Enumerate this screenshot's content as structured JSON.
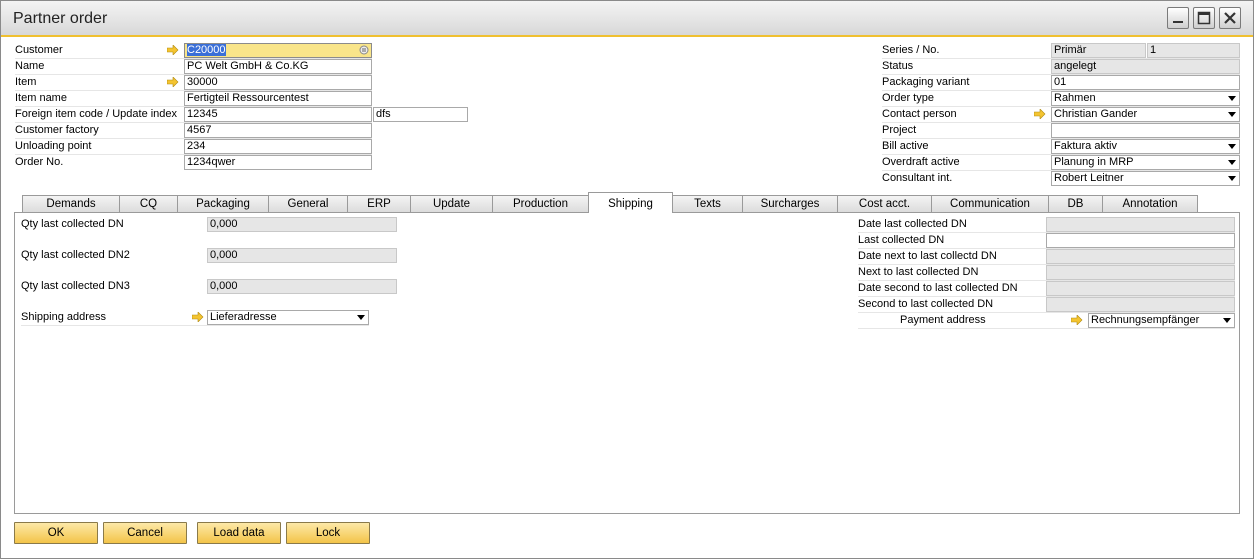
{
  "window": {
    "title": "Partner order"
  },
  "header_left": [
    {
      "label": "Customer",
      "value": "C20000",
      "link": true
    },
    {
      "label": "Name",
      "value": "PC Welt GmbH & Co.KG"
    },
    {
      "label": "Item",
      "value": "30000",
      "link": true
    },
    {
      "label": "Item name",
      "value": "Fertigteil Ressourcentest"
    },
    {
      "label": "Foreign item code / Update index",
      "value": "12345",
      "value2": "dfs"
    },
    {
      "label": "Customer factory",
      "value": "4567"
    },
    {
      "label": "Unloading point",
      "value": "234"
    },
    {
      "label": "Order No.",
      "value": "1234qwer"
    }
  ],
  "header_right": [
    {
      "label": "Series / No.",
      "value": "Primär",
      "value2": "1"
    },
    {
      "label": "Status",
      "value": "angelegt"
    },
    {
      "label": "Packaging variant",
      "value": "01"
    },
    {
      "label": "Order type",
      "value": "Rahmen"
    },
    {
      "label": "Contact person",
      "value": "Christian Gander",
      "link": true
    },
    {
      "label": "Project",
      "value": ""
    },
    {
      "label": "Bill active",
      "value": "Faktura aktiv"
    },
    {
      "label": "Overdraft active",
      "value": "Planung in MRP"
    },
    {
      "label": "Consultant int.",
      "value": "Robert Leitner"
    }
  ],
  "tabs": [
    "Demands",
    "CQ",
    "Packaging",
    "General",
    "ERP",
    "Update",
    "Production",
    "Shipping",
    "Texts",
    "Surcharges",
    "Cost acct.",
    "Communication",
    "DB",
    "Annotation"
  ],
  "active_tab": "Shipping",
  "shipping_left": [
    {
      "label": "Qty last collected DN",
      "value": "0,000"
    },
    {
      "label": "Qty last collected DN2",
      "value": "0,000"
    },
    {
      "label": "Qty last collected DN3",
      "value": "0,000"
    },
    {
      "label": "Shipping address",
      "value": "Lieferadresse"
    }
  ],
  "shipping_right": [
    {
      "label": "Date last collected DN",
      "value": ""
    },
    {
      "label": "Last collected DN",
      "value": ""
    },
    {
      "label": "Date next to last collectd DN",
      "value": ""
    },
    {
      "label": "Next to last collected DN",
      "value": ""
    },
    {
      "label": "Date second to last collected DN",
      "value": ""
    },
    {
      "label": "Second to last collected DN",
      "value": ""
    },
    {
      "label": "Payment address",
      "value": "Rechnungsempfänger"
    }
  ],
  "buttons": {
    "ok": "OK",
    "cancel": "Cancel",
    "load": "Load data",
    "lock": "Lock"
  },
  "colors": {
    "accent": "#f0c030",
    "button": "#f3c449",
    "selected_field": "#f9e58a"
  }
}
